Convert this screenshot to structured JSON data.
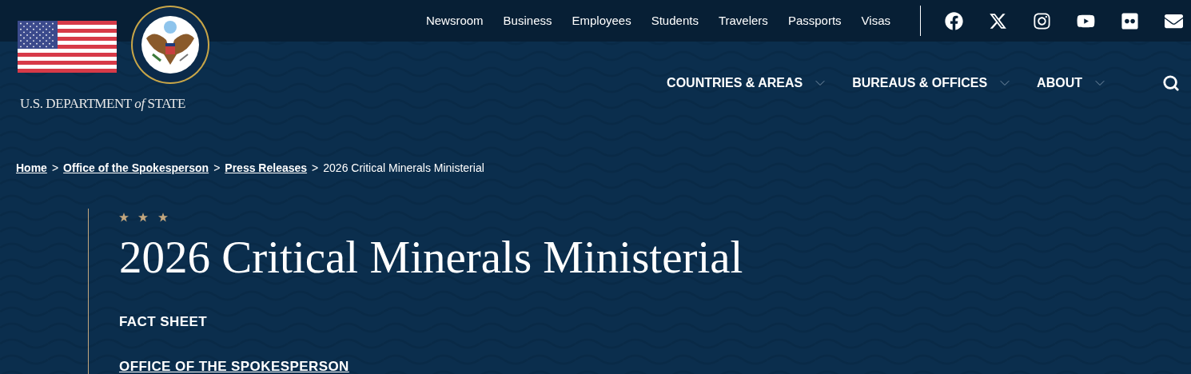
{
  "brand": {
    "wordmark": "U.S. DEPARTMENT *of* STATE"
  },
  "utility_links": [
    "Newsroom",
    "Business",
    "Employees",
    "Students",
    "Travelers",
    "Passports",
    "Visas"
  ],
  "social": [
    {
      "kind": "facebook"
    },
    {
      "kind": "x"
    },
    {
      "kind": "instagram"
    },
    {
      "kind": "youtube"
    },
    {
      "kind": "flickr"
    },
    {
      "kind": "email"
    }
  ],
  "main_nav": [
    {
      "label": "COUNTRIES & AREAS",
      "expanded": false
    },
    {
      "label": "BUREAUS & OFFICES",
      "expanded": false
    },
    {
      "label": "ABOUT",
      "expanded": false
    }
  ],
  "breadcrumb": [
    {
      "label": "Home",
      "link": true
    },
    {
      "label": "Office of the Spokesperson",
      "link": true
    },
    {
      "label": "Press Releases",
      "link": true
    },
    {
      "label": "2026 Critical Minerals Ministerial",
      "link": false
    }
  ],
  "breadcrumb_separator": ">",
  "article": {
    "title": "2026 Critical Minerals Ministerial",
    "type": "FACT SHEET",
    "office": "OFFICE OF THE SPOKESPERSON"
  }
}
